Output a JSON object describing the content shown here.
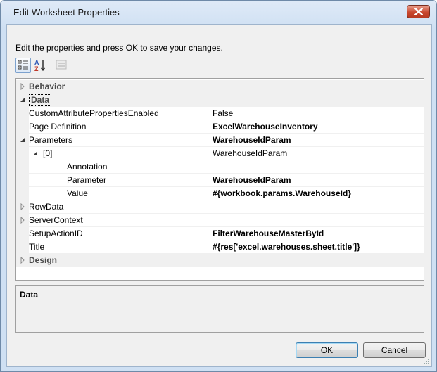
{
  "window": {
    "title": "Edit Worksheet Properties"
  },
  "instructions": "Edit the properties and press OK to save your changes.",
  "toolbar": {
    "categorized_icon": "categorized-icon",
    "alphabetical_icon": "sort-alphabetical-icon",
    "property_pages_icon": "property-pages-icon"
  },
  "grid": {
    "rows": [
      {
        "type": "category",
        "name": "Behavior",
        "expanded": false
      },
      {
        "type": "category",
        "name": "Data",
        "expanded": true
      },
      {
        "type": "property",
        "name": "CustomAttributePropertiesEnabled",
        "value": "False",
        "bold": false
      },
      {
        "type": "property",
        "name": "Page Definition",
        "value": "ExcelWarehouseInventory",
        "bold": true
      },
      {
        "type": "property",
        "name": "Parameters",
        "value": "WarehouseIdParam",
        "bold": true,
        "expanded": true
      },
      {
        "type": "property",
        "name": "[0]",
        "value": "WarehouseIdParam",
        "bold": false,
        "expanded": true
      },
      {
        "type": "property",
        "name": "Annotation",
        "value": "",
        "bold": false
      },
      {
        "type": "property",
        "name": "Parameter",
        "value": "WarehouseIdParam",
        "bold": true
      },
      {
        "type": "property",
        "name": "Value",
        "value": "#{workbook.params.WarehouseId}",
        "bold": true
      },
      {
        "type": "property",
        "name": "RowData",
        "value": "",
        "bold": false,
        "expanded": false
      },
      {
        "type": "property",
        "name": "ServerContext",
        "value": "",
        "bold": false,
        "expanded": false
      },
      {
        "type": "property",
        "name": "SetupActionID",
        "value": "FilterWarehouseMasterById",
        "bold": true
      },
      {
        "type": "property",
        "name": "Title",
        "value": "#{res['excel.warehouses.sheet.title']}",
        "bold": true
      },
      {
        "type": "category",
        "name": "Design",
        "expanded": false
      }
    ]
  },
  "description": {
    "title": "Data"
  },
  "buttons": {
    "ok": "OK",
    "cancel": "Cancel"
  },
  "colors": {
    "close_button": "#c9482f",
    "category_text": "#4a4a4a",
    "window_frame": "#cfe0f3"
  }
}
